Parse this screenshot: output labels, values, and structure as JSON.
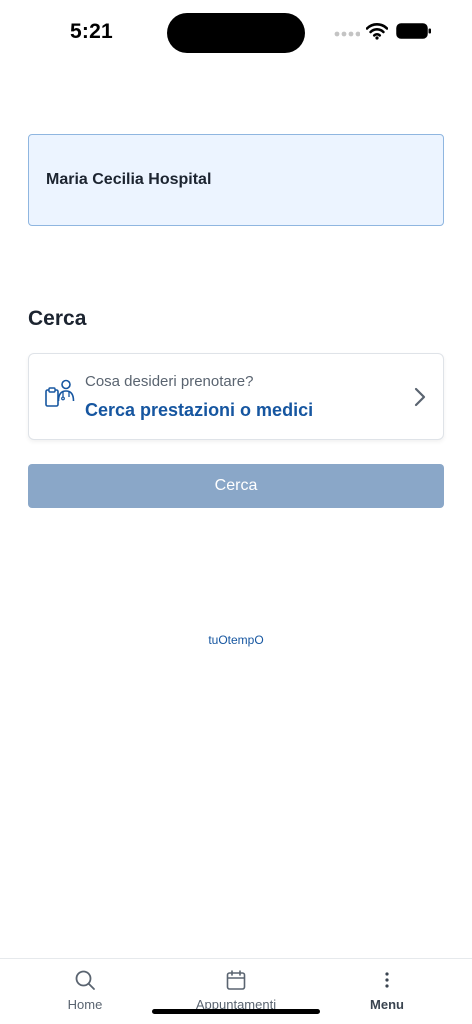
{
  "status_bar": {
    "time": "5:21"
  },
  "hospital": {
    "name": "Maria Cecilia Hospital"
  },
  "search_section": {
    "title": "Cerca",
    "prompt": "Cosa desideri prenotare?",
    "action": "Cerca prestazioni o medici",
    "button_label": "Cerca"
  },
  "footer": {
    "brand": "tuOtempO"
  },
  "tab_bar": {
    "items": [
      {
        "label": "Home",
        "icon": "search-icon"
      },
      {
        "label": "Appuntamenti",
        "icon": "calendar-icon"
      },
      {
        "label": "Menu",
        "icon": "more-vertical-icon",
        "active": true
      }
    ]
  },
  "colors": {
    "accent": "#1656a0",
    "button_disabled": "#8aa7c8",
    "card_bg": "#ecf4ff",
    "card_border": "#8fb6e0"
  }
}
